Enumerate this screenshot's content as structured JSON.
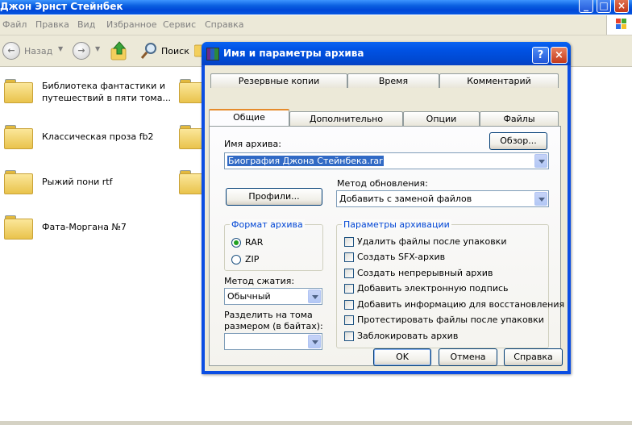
{
  "explorer": {
    "title": "Джон Эрнст Стейнбек",
    "menu": [
      "Файл",
      "Правка",
      "Вид",
      "Избранное",
      "Сервис",
      "Справка"
    ],
    "toolbar": {
      "back": "Назад",
      "search": "Поиск"
    },
    "folders": [
      "Библиотека фантастики и путешествий в пяти тома...",
      "Классическая проза fb2",
      "Рыжий пони rtf",
      "Фата-Моргана №7"
    ]
  },
  "dialog": {
    "title": "Имя и параметры архива",
    "tabs_back": [
      "Резервные копии",
      "Время",
      "Комментарий"
    ],
    "tabs_front": [
      "Общие",
      "Дополнительно",
      "Опции",
      "Файлы"
    ],
    "active_tab": "Общие",
    "archive_name_label": "Имя архива:",
    "browse_button": "Обзор...",
    "archive_name_value": "Биография Джона Стейнбека.rar",
    "profiles_button": "Профили...",
    "update_method_label": "Метод обновления:",
    "update_method_value": "Добавить с заменой файлов",
    "format_group": "Формат архива",
    "formats": [
      {
        "label": "RAR",
        "selected": true
      },
      {
        "label": "ZIP",
        "selected": false
      }
    ],
    "compression_label": "Метод сжатия:",
    "compression_value": "Обычный",
    "split_label": "Разделить на тома размером (в байтах):",
    "split_label_line1": "Разделить на тома",
    "split_label_line2": "размером (в байтах):",
    "split_value": "",
    "options_group": "Параметры архивации",
    "options": [
      {
        "label": "Удалить файлы после упаковки",
        "checked": false
      },
      {
        "label": "Создать SFX-архив",
        "checked": false
      },
      {
        "label": "Создать непрерывный архив",
        "checked": false
      },
      {
        "label": "Добавить электронную подпись",
        "checked": false
      },
      {
        "label": "Добавить информацию для восстановления",
        "checked": false
      },
      {
        "label": "Протестировать файлы после упаковки",
        "checked": false
      },
      {
        "label": "Заблокировать архив",
        "checked": false
      }
    ],
    "ok_button": "OK",
    "cancel_button": "Отмена",
    "help_button": "Справка"
  }
}
